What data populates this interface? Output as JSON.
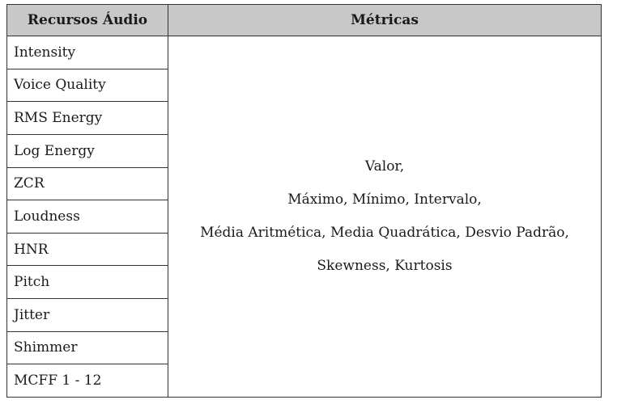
{
  "table": {
    "headers": {
      "features": "Recursos Áudio",
      "metrics": "Métricas"
    },
    "features": [
      "Intensity",
      "Voice Quality",
      "RMS Energy",
      "Log Energy",
      "ZCR",
      "Loudness",
      "HNR",
      "Pitch",
      "Jitter",
      "Shimmer",
      "MCFF 1 - 12"
    ],
    "metrics_lines": [
      "Valor,",
      "Máximo, Mínimo, Intervalo,",
      "Média Aritmética, Media Quadrática, Desvio Padrão,",
      "Skewness, Kurtosis"
    ]
  }
}
